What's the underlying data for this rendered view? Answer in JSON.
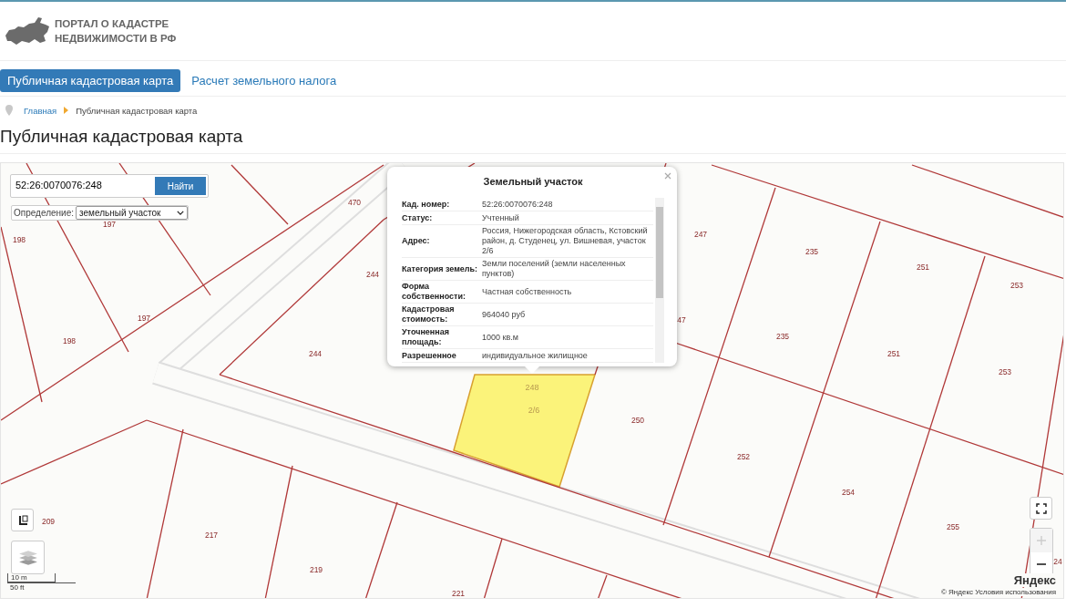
{
  "header": {
    "logo_lines": [
      "ПОРТАЛ О КАДАСТРЕ",
      "НЕДВИЖИМОСТИ В РФ"
    ]
  },
  "nav": [
    {
      "label": "Публичная кадастровая карта",
      "selected": true
    },
    {
      "label": "Расчет земельного налога",
      "selected": false
    }
  ],
  "breadcrumb": [
    {
      "label": "Главная",
      "kind": "link"
    },
    {
      "label": "Публичная кадастровая карта",
      "kind": "current"
    }
  ],
  "page_title": "Публичная кадастровая карта",
  "map": {
    "search": {
      "value": "52:26:0070076:248",
      "button": "Найти"
    },
    "definition": {
      "label": "Определение:",
      "value": "земельный участок"
    },
    "parcel_labels": [
      {
        "text": "470",
        "selected": false
      },
      {
        "text": "198",
        "selected": false
      },
      {
        "text": "197",
        "selected": false
      },
      {
        "text": "244",
        "selected": false
      },
      {
        "text": "197",
        "selected": false
      },
      {
        "text": "198",
        "selected": false
      },
      {
        "text": "244",
        "selected": false
      },
      {
        "text": "248",
        "selected": true
      },
      {
        "text": "2/6",
        "selected": true
      },
      {
        "text": "247",
        "selected": false
      },
      {
        "text": "235",
        "selected": false
      },
      {
        "text": "251",
        "selected": false
      },
      {
        "text": "253",
        "selected": false
      },
      {
        "text": "47",
        "selected": false
      },
      {
        "text": "235",
        "selected": false
      },
      {
        "text": "251",
        "selected": false
      },
      {
        "text": "253",
        "selected": false
      },
      {
        "text": "250",
        "selected": false
      },
      {
        "text": "252",
        "selected": false
      },
      {
        "text": "254",
        "selected": false
      },
      {
        "text": "255",
        "selected": false
      },
      {
        "text": "209",
        "selected": false
      },
      {
        "text": "217",
        "selected": false
      },
      {
        "text": "219",
        "selected": false
      },
      {
        "text": "221",
        "selected": false
      },
      {
        "text": "24",
        "selected": false
      }
    ]
  },
  "popup": {
    "title": "Земельный участок",
    "rows": [
      {
        "label": "Кад. номер:",
        "value": "52:26:0070076:248"
      },
      {
        "label": "Статус:",
        "value": "Учтенный"
      },
      {
        "label": "Адрес:",
        "value": "Россия, Нижегородская область, Кстовский район, д. Студенец, ул. Вишневая, участок 2/6"
      },
      {
        "label": "Категория земель:",
        "value": "Земли поселений (земли населенных пунктов)"
      },
      {
        "label": "Форма собственности:",
        "value": "Частная собственность"
      },
      {
        "label": "Кадастровая стоимость:",
        "value": "964040 руб"
      },
      {
        "label": "Уточненная площадь:",
        "value": "1000 кв.м"
      },
      {
        "label": "Разрешенное",
        "value": "индивидуальное жилищное"
      }
    ]
  },
  "zoom_in": {
    "disabled": true
  },
  "zoom_out": {
    "disabled": false
  },
  "scale": [
    "10 m",
    "50 ft"
  ],
  "attribution": {
    "logo": "Яндекс",
    "terms": "© Яндекс Условия использования"
  }
}
